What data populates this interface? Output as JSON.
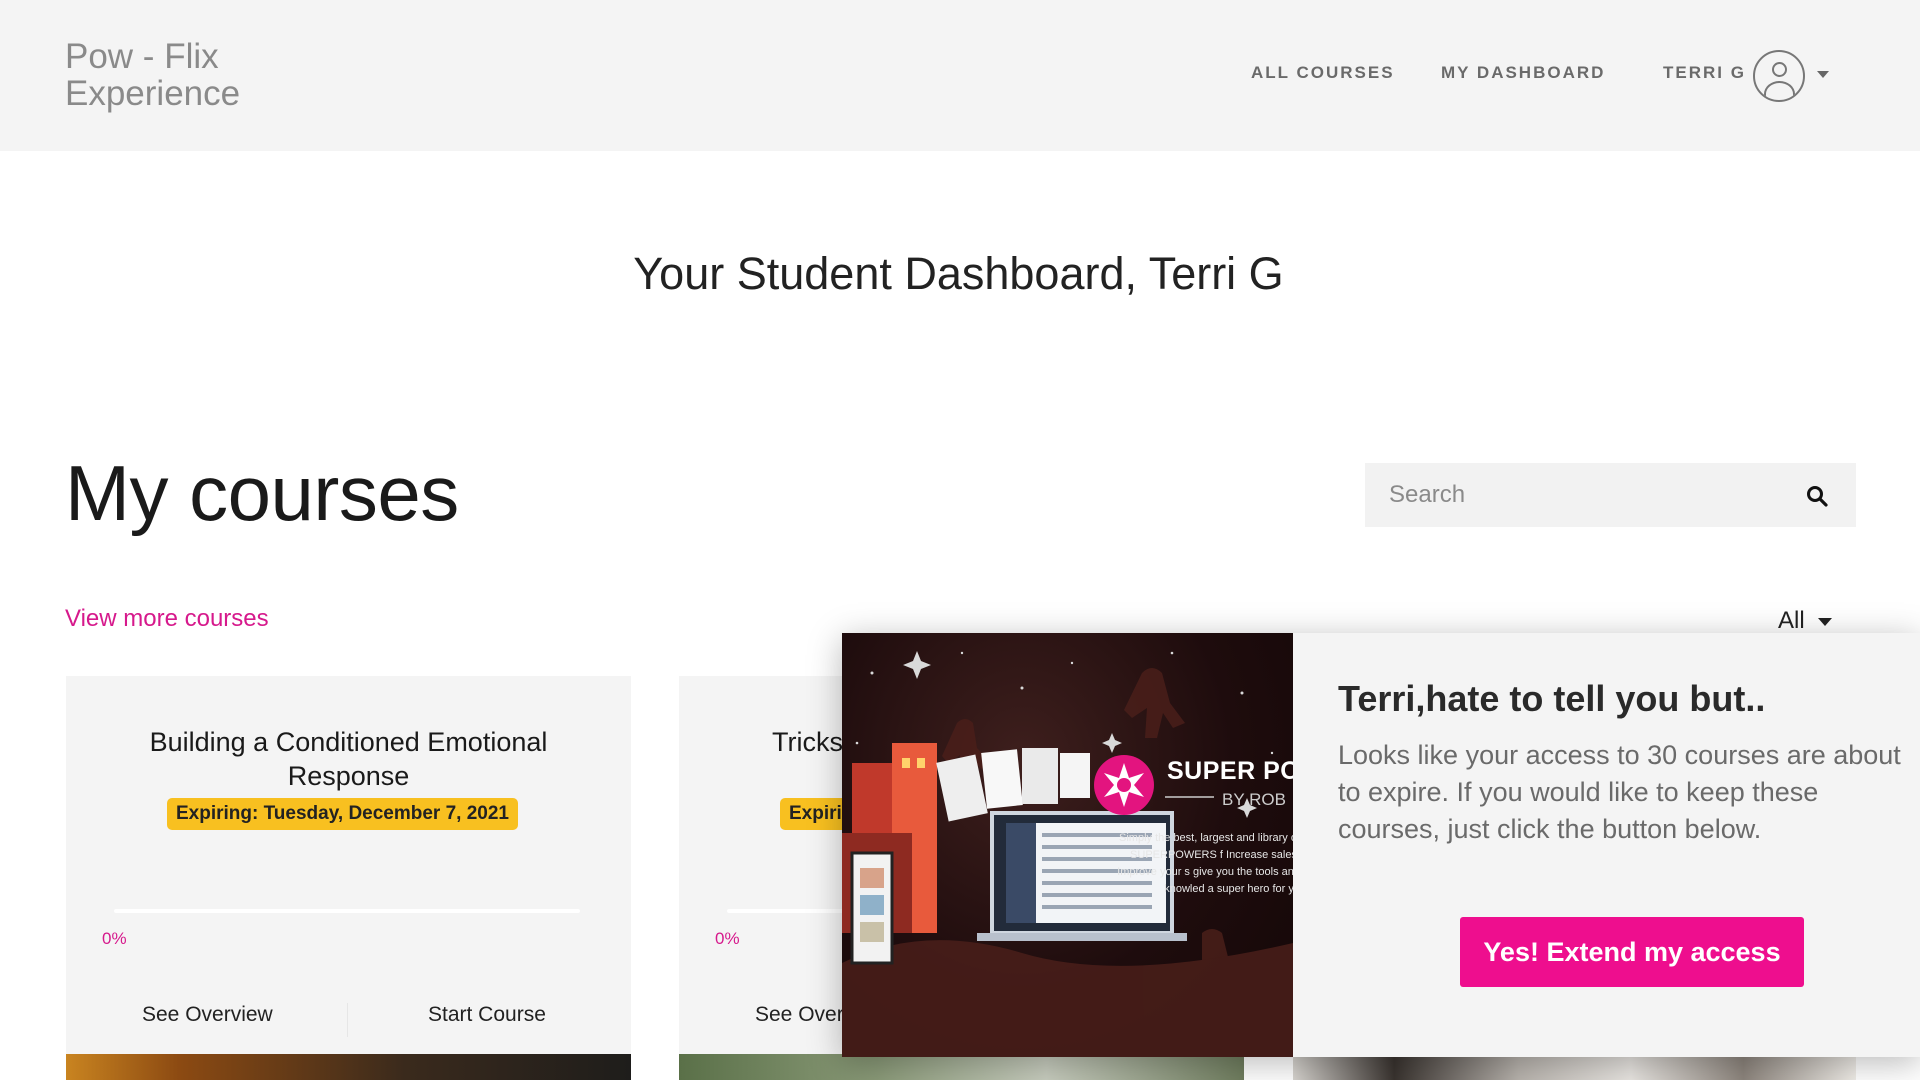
{
  "header": {
    "logo_line1": "Pow - Flix",
    "logo_line2": "Experience",
    "nav": {
      "all_courses": "ALL COURSES",
      "my_dashboard": "MY DASHBOARD",
      "user": "TERRI G"
    }
  },
  "page": {
    "title": "Your Student Dashboard, Terri G",
    "section_title": "My courses",
    "view_more": "View more courses",
    "filter_value": "All"
  },
  "search": {
    "placeholder": "Search"
  },
  "courses": [
    {
      "title": "Building a Conditioned Emotional Response",
      "expiring": "Expiring: Tuesday, December 7, 2021",
      "progress": "0%",
      "overview_label": "See Overview",
      "start_label": "Start Course"
    },
    {
      "title": "Tricks",
      "expiring": "Expiri",
      "progress": "0%",
      "overview_label": "See Over"
    }
  ],
  "popup": {
    "title": "Terri,hate to tell you but..",
    "message": "Looks like your access to 30 courses are about to expire. If you would like to keep these courses, just click the button below.",
    "button": "Yes! Extend my access",
    "image": {
      "brand": "SUPER PO",
      "by": "BY ROB",
      "desc": "Simply the best, largest and library of SUPERPOWERS f Increase sales. Improve your s give you the tools and knowled a super hero for yo"
    }
  },
  "colors": {
    "accent_pink": "#d6198c",
    "button_pink": "#ee0e8e",
    "expiring_yellow": "#f8c020",
    "header_bg": "#f4f4f4"
  },
  "icons": {
    "search": "search-icon",
    "user": "user-avatar-icon",
    "dropdown": "caret-down-icon"
  }
}
